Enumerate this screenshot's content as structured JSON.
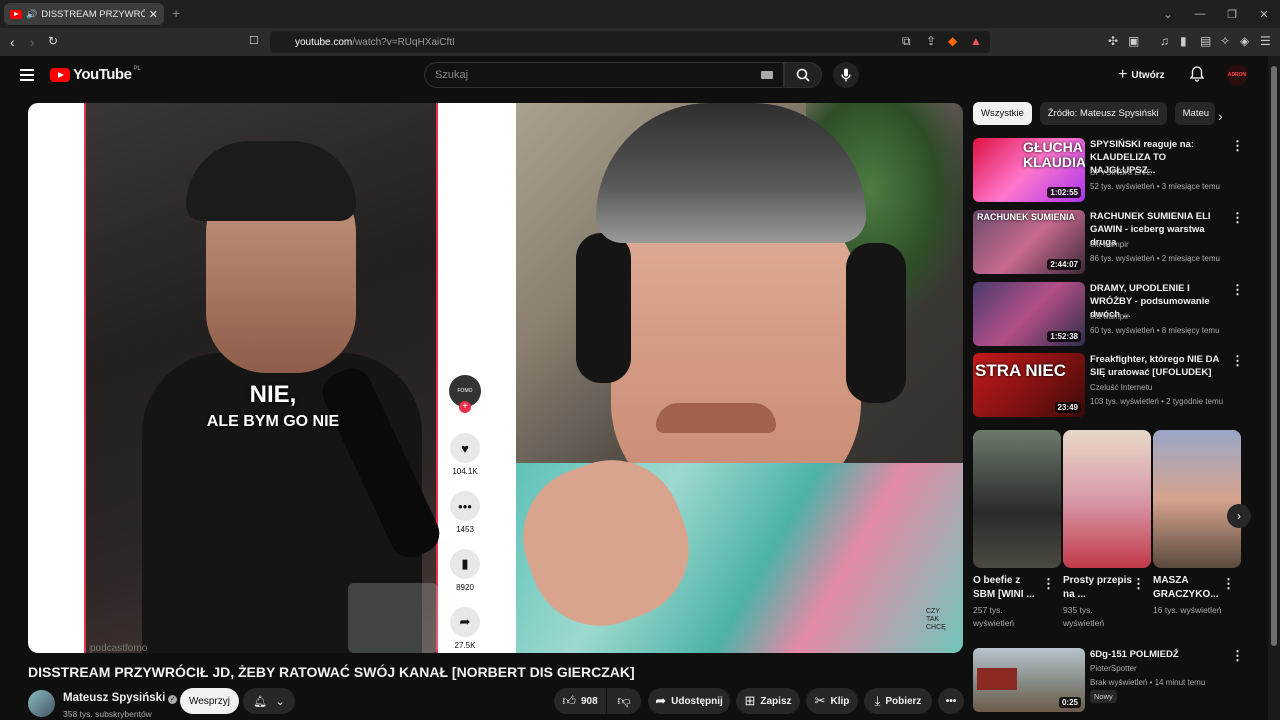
{
  "browser": {
    "tab_title": "DISSTREAM PRZYWRÓCIŁ JD",
    "url_domain": "youtube.com",
    "url_path": "/watch?v=RUqHXaiCftI"
  },
  "header": {
    "logo_text": "YouTube",
    "logo_region": "PL",
    "search_placeholder": "Szukaj",
    "create_label": "Utwórz",
    "avatar_text": "ADRON"
  },
  "player": {
    "caption_line1": "NIE,",
    "caption_line2": "ALE BYM GO NIE",
    "watermark": "podcastfomo",
    "tiktok": {
      "likes": "104.1K",
      "comments": "1453",
      "saves": "8920",
      "shares": "27.5K"
    }
  },
  "video": {
    "title": "DISSTREAM PRZYWRÓCIŁ JD, ŻEBY RATOWAĆ SWÓJ KANAŁ [NORBERT DIS GIERCZAK]",
    "channel": "Mateusz Spysiński",
    "subscribers": "358 tys. subskrybentów",
    "support_label": "Wesprzyj",
    "likes": "908",
    "share_label": "Udostępnij",
    "save_label": "Zapisz",
    "clip_label": "Klip",
    "download_label": "Pobierz"
  },
  "chips": [
    "Wszystkie",
    "Źródło: Mateusz Spysiński",
    "Mateu"
  ],
  "related": [
    {
      "title": "SPYSIŃSKI reaguje na: KLAUDELIZA TO NAJGŁUPSZ...",
      "channel": "SPYSIŃSKI LIVE",
      "meta": "52 tys. wyświetleń • 3 miesiące temu",
      "duration": "1:02:55",
      "thumb_text": "GŁUCHA KLAUDIA"
    },
    {
      "title": "RACHUNEK SUMIENIA ELI GAWIN - iceberg warstwa druga",
      "channel": "ela wampir",
      "meta": "86 tys. wyświetleń • 2 miesiące temu",
      "duration": "2:44:07",
      "thumb_text": "RACHUNEK SUMIENIA"
    },
    {
      "title": "DRAMY, UPODLENIE I WRÓŻBY - podsumowanie dwóch ...",
      "channel": "ela wampir",
      "meta": "60 tys. wyświetleń • 8 miesięcy temu",
      "duration": "1:52:38",
      "thumb_text": ""
    },
    {
      "title": "Freakfighter, którego NIE DA SIĘ uratować [UFOLUDEK]",
      "channel": "Czeluść Internetu",
      "meta": "103 tys. wyświetleń • 2 tygodnie temu",
      "duration": "23:49",
      "thumb_text": "STRA NIEC"
    }
  ],
  "shorts": [
    {
      "title": "O beefie z SBM [WINI ...",
      "views": "257 tys. wyświetleń"
    },
    {
      "title": "Prosty przepis na ...",
      "views": "935 tys. wyświetleń"
    },
    {
      "title": "MASZA GRACZYKO...",
      "views": "16 tys. wyświetleń"
    }
  ],
  "last_video": {
    "title": "6Dg-151 POLMIEDŹ",
    "channel": "PioterSpotter",
    "meta": "Brak wyświetleń • 14 minut temu",
    "badge": "Nowy",
    "duration": "0:25"
  },
  "colors": {
    "brand_red": "#ff0000",
    "background": "#0f0f0f",
    "chip_bg": "#272727"
  }
}
